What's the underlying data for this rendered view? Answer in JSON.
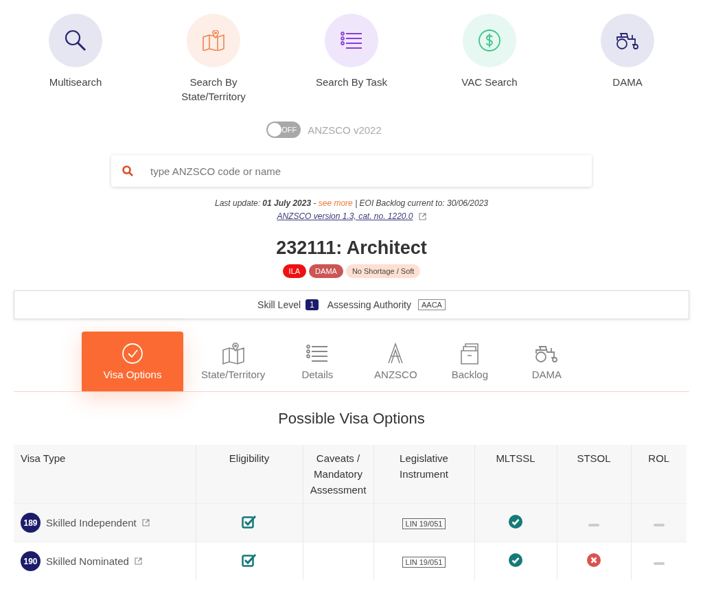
{
  "nav": [
    {
      "label": "Multisearch"
    },
    {
      "label": "Search By State/Territory"
    },
    {
      "label": "Search By Task"
    },
    {
      "label": "VAC Search"
    },
    {
      "label": "DAMA"
    }
  ],
  "toggle": {
    "on": false,
    "state_text": "OFF",
    "label": "ANZSCO v2022"
  },
  "search": {
    "placeholder": "type ANZSCO code or name"
  },
  "update": {
    "before": "Last update: **01 July 2023** - ",
    "link": "see more",
    "after": " | EOI Backlog current to: 30/06/2023"
  },
  "anzsco_link": "ANZSCO version 1.3, cat. no. 1220.0",
  "title": "232111: Architect",
  "badges": [
    {
      "label": "ILA",
      "color": "#ee1111"
    },
    {
      "label": "DAMA",
      "color": "#cc5555"
    },
    {
      "label": "No Shortage / Soft",
      "color": "#fde0d2"
    }
  ],
  "info": {
    "skill_label": "Skill Level",
    "skill_level": "1",
    "authority_label": "Assessing Authority",
    "authority": "AACA"
  },
  "tabs": [
    {
      "label": "Visa Options",
      "selected": true
    },
    {
      "label": "State/Territory",
      "selected": false
    },
    {
      "label": "Details",
      "selected": false
    },
    {
      "label": "ANZSCO",
      "selected": false
    },
    {
      "label": "Backlog",
      "selected": false
    },
    {
      "label": "DAMA",
      "selected": false
    }
  ],
  "section_title": "Possible Visa Options",
  "visa_table": {
    "columns": [
      "Visa Type",
      "Eligibility",
      "Caveats / Mandatory Assessment",
      "Legislative Instrument",
      "MLTSSL",
      "STSOL",
      "ROL"
    ],
    "rows": [
      {
        "code": "189",
        "name": "Skilled Independent",
        "eligible": true,
        "instrument": "LIN 19/051",
        "lists": [
          {
            "kind": "check"
          },
          {
            "kind": "dash"
          },
          {
            "kind": "dash"
          }
        ]
      },
      {
        "code": "190",
        "name": "Skilled Nominated",
        "eligible": true,
        "instrument": "LIN 19/051",
        "lists": [
          {
            "kind": "check"
          },
          {
            "kind": "cross"
          },
          {
            "kind": "dash"
          }
        ]
      }
    ]
  }
}
